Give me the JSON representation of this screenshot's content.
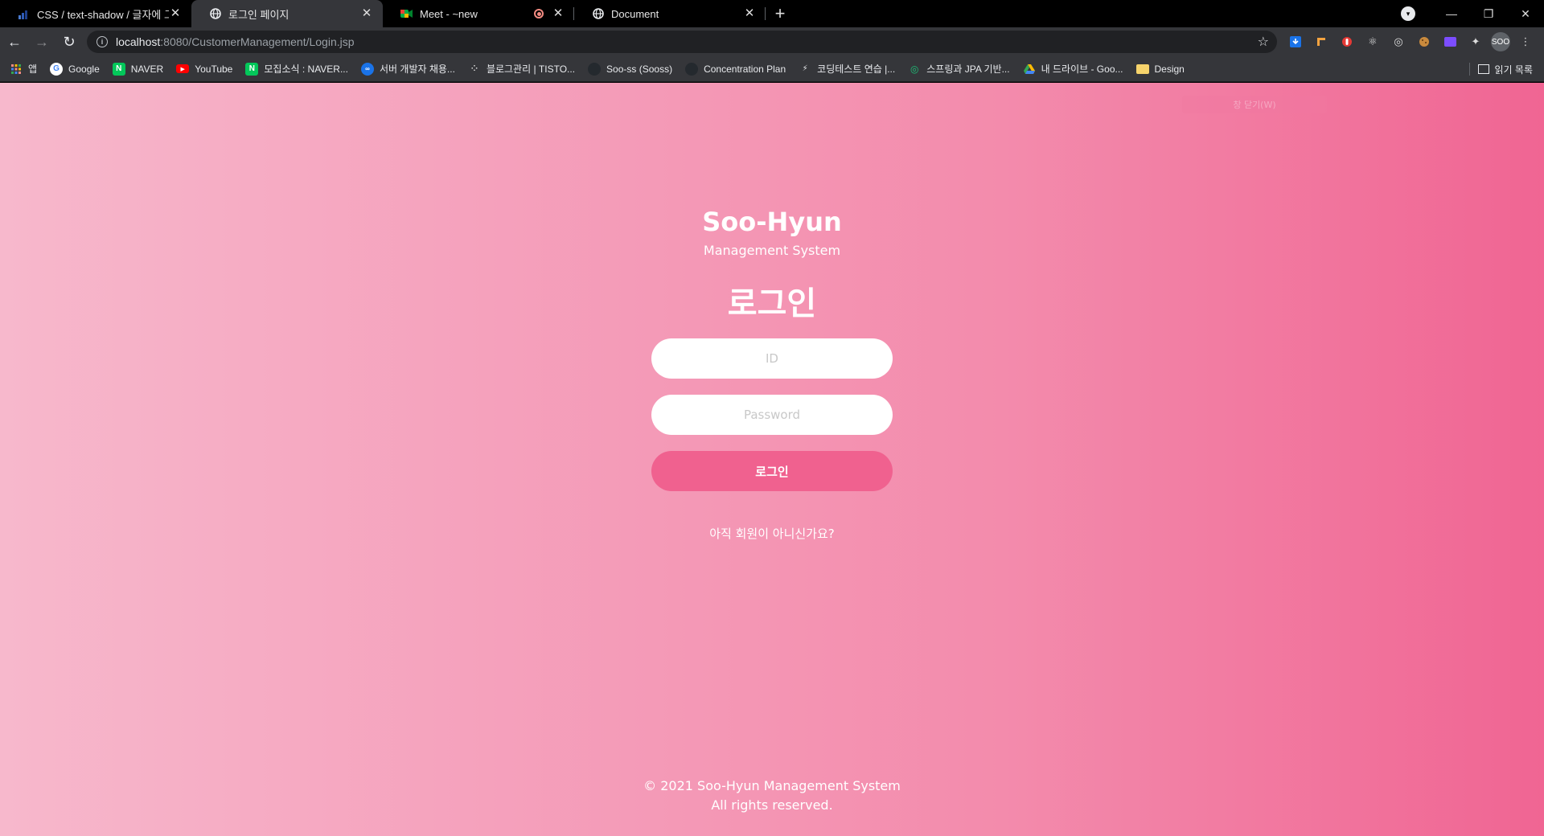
{
  "browser": {
    "tabs": [
      {
        "title": "CSS / text-shadow / 글자에 그림자",
        "icon": "blog-icon"
      },
      {
        "title": "로그인 페이지",
        "icon": "globe-icon"
      },
      {
        "title": "Meet - ~new",
        "icon": "meet-icon"
      },
      {
        "title": "Document",
        "icon": "globe-icon"
      }
    ],
    "url_host": "localhost",
    "url_path": ":8080/CustomerManagement/Login.jsp",
    "profile_label": "SOO",
    "bookmarks": [
      {
        "label": "앱",
        "icon": "apps-grid-icon"
      },
      {
        "label": "Google",
        "icon": "google-icon"
      },
      {
        "label": "NAVER",
        "icon": "naver-icon"
      },
      {
        "label": "YouTube",
        "icon": "youtube-icon"
      },
      {
        "label": "모집소식 : NAVER...",
        "icon": "naver-icon"
      },
      {
        "label": "서버 개발자 채용...",
        "icon": "loop-icon"
      },
      {
        "label": "블로그관리 | TISTO...",
        "icon": "tistory-icon"
      },
      {
        "label": "Soo-ss (Sooss)",
        "icon": "github-icon"
      },
      {
        "label": "Concentration Plan",
        "icon": "github-icon"
      },
      {
        "label": "코딩테스트 연습 |...",
        "icon": "programmers-icon"
      },
      {
        "label": "스프링과 JPA 기반...",
        "icon": "inflearn-icon"
      },
      {
        "label": "내 드라이브 - Goo...",
        "icon": "drive-icon"
      },
      {
        "label": "Design",
        "icon": "folder-icon"
      }
    ],
    "reading_list": "읽기 목록",
    "colors": {
      "tab_bar": "#000000",
      "toolbar": "#35363a",
      "omnibox": "#202124"
    }
  },
  "page": {
    "ghost_text": "창 닫기(W)",
    "brand": "Soo-Hyun",
    "subbrand": "Management System",
    "heading": "로그인",
    "id_placeholder": "ID",
    "password_placeholder": "Password",
    "login_button": "로그인",
    "signup_link": "아직 회원이 아니신가요?",
    "footer_line1": "© 2021 Soo-Hyun Management System",
    "footer_line2": "All rights reserved.",
    "colors": {
      "gradient_start": "#f7b8cc",
      "gradient_end": "#f06593",
      "button": "#f0618f"
    }
  }
}
